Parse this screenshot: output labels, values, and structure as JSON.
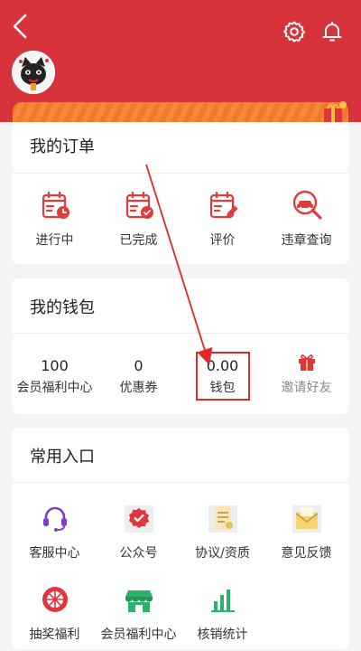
{
  "colors": {
    "brand": "#d8333b",
    "accent_red": "#e23b3b",
    "green": "#2bb36b",
    "purple": "#7b3fd0",
    "annotation": "#e02a2a"
  },
  "header": {
    "icons": [
      "back-arrow-icon",
      "gear-icon",
      "bell-icon"
    ]
  },
  "orders": {
    "title": "我的订单",
    "items": [
      {
        "label": "进行中",
        "icon": "calendar-clock-icon"
      },
      {
        "label": "已完成",
        "icon": "calendar-check-icon"
      },
      {
        "label": "评价",
        "icon": "calendar-edit-icon"
      },
      {
        "label": "违章查询",
        "icon": "search-car-icon"
      }
    ]
  },
  "wallet": {
    "title": "我的钱包",
    "items": [
      {
        "value": "100",
        "label": "会员福利中心"
      },
      {
        "value": "0",
        "label": "优惠券"
      },
      {
        "value": "0.00",
        "label": "钱包"
      },
      {
        "label": "邀请好友",
        "icon": "gift-icon"
      }
    ]
  },
  "entry": {
    "title": "常用入口",
    "items": [
      {
        "label": "客服中心",
        "icon": "headset-icon"
      },
      {
        "label": "公众号",
        "icon": "badge-icon"
      },
      {
        "label": "协议/资质",
        "icon": "document-icon"
      },
      {
        "label": "意见反馈",
        "icon": "mail-icon"
      },
      {
        "label": "抽奖福利",
        "icon": "lottery-wheel-icon"
      },
      {
        "label": "会员福利中心",
        "icon": "store-icon"
      },
      {
        "label": "核销统计",
        "icon": "bar-chart-icon"
      }
    ]
  }
}
